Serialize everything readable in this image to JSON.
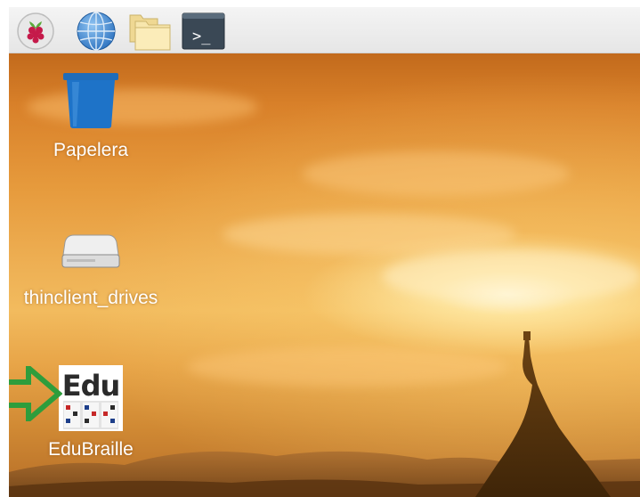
{
  "taskbar": {
    "buttons": [
      {
        "name": "menu",
        "icon": "raspberry-icon"
      },
      {
        "name": "web-browser",
        "icon": "globe-icon"
      },
      {
        "name": "file-manager",
        "icon": "folders-icon"
      },
      {
        "name": "terminal",
        "icon": "terminal-icon",
        "glyph": ">_"
      }
    ]
  },
  "desktop": {
    "wallpaper": "sunset-temple",
    "icons": [
      {
        "label": "Papelera",
        "icon": "trash-icon"
      },
      {
        "label": "thinclient_drives",
        "icon": "drive-icon"
      },
      {
        "label": "EduBraille",
        "icon": "edubraille-icon",
        "logo_text": "Edu"
      }
    ]
  },
  "annotation": {
    "icon": "arrow-right-icon",
    "color": "#2e9d3c"
  },
  "colors": {
    "trash_blue": "#1e73c8",
    "taskbar_bg": "#eeeeee"
  }
}
